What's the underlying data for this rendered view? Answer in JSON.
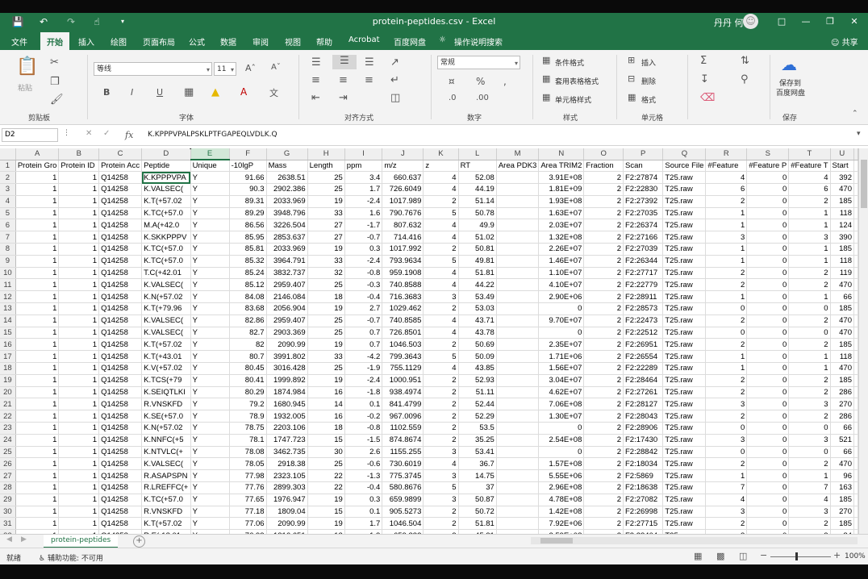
{
  "window": {
    "doc_title": "protein-peptides.csv - Excel",
    "user": "丹丹 何",
    "quick_access": [
      "save-icon",
      "undo-icon",
      "redo-icon",
      "touch-mode-icon",
      "customize-icon"
    ]
  },
  "ribbon_tabs": [
    "文件",
    "开始",
    "插入",
    "绘图",
    "页面布局",
    "公式",
    "数据",
    "审阅",
    "视图",
    "帮助",
    "Acrobat",
    "百度网盘",
    "操作说明搜索"
  ],
  "share_label": "共享",
  "ribbon": {
    "clipboard": {
      "paste": "粘贴",
      "label": "剪贴板"
    },
    "font": {
      "name": "等线",
      "size": "11",
      "label": "字体"
    },
    "alignment": {
      "label": "对齐方式"
    },
    "number": {
      "format": "常规",
      "label": "数字"
    },
    "styles": {
      "conditional": "条件格式",
      "table": "套用表格格式",
      "cell": "单元格样式",
      "label": "样式"
    },
    "cells": {
      "insert": "插入",
      "delete": "删除",
      "format": "格式",
      "label": "单元格"
    },
    "save": {
      "line1": "保存到",
      "line2": "百度网盘",
      "label": "保存"
    }
  },
  "formula_bar": {
    "name_box": "D2",
    "fx": "fx",
    "formula": "K.KPPPVPALPSKLPTFGAPEQLVDLK.Q"
  },
  "columns": [
    "A",
    "B",
    "C",
    "D",
    "E",
    "F",
    "G",
    "H",
    "I",
    "J",
    "K",
    "L",
    "M",
    "N",
    "O",
    "P",
    "Q",
    "R",
    "S",
    "T",
    "U"
  ],
  "headers": [
    "Protein Gro",
    "Protein ID",
    "Protein Acc",
    "Peptide",
    "Unique",
    "-10lgP",
    "Mass",
    "Length",
    "ppm",
    "m/z",
    "z",
    "RT",
    "Area PDK3",
    "Area TRIM2",
    "Fraction",
    "Scan",
    "Source File",
    "#Feature",
    "#Feature P",
    "#Feature T",
    "Start"
  ],
  "rows": [
    [
      "1",
      "1",
      "Q14258",
      "K.KPPPVPA",
      "Y",
      "91.66",
      "2638.51",
      "25",
      "3.4",
      "660.637",
      "4",
      "52.08",
      "",
      "3.91E+08",
      "2",
      "F2:27874",
      "T25.raw",
      "4",
      "0",
      "4",
      "392"
    ],
    [
      "1",
      "1",
      "Q14258",
      "K.VALSEC(",
      "Y",
      "90.3",
      "2902.386",
      "25",
      "1.7",
      "726.6049",
      "4",
      "44.19",
      "",
      "1.81E+09",
      "2",
      "F2:22830",
      "T25.raw",
      "6",
      "0",
      "6",
      "470"
    ],
    [
      "1",
      "1",
      "Q14258",
      "K.T(+57.02",
      "Y",
      "89.31",
      "2033.969",
      "19",
      "-2.4",
      "1017.989",
      "2",
      "51.14",
      "",
      "1.93E+08",
      "2",
      "F2:27392",
      "T25.raw",
      "2",
      "0",
      "2",
      "185"
    ],
    [
      "1",
      "1",
      "Q14258",
      "K.TC(+57.0",
      "Y",
      "89.29",
      "3948.796",
      "33",
      "1.6",
      "790.7676",
      "5",
      "50.78",
      "",
      "1.63E+07",
      "2",
      "F2:27035",
      "T25.raw",
      "1",
      "0",
      "1",
      "118"
    ],
    [
      "1",
      "1",
      "Q14258",
      "M.A(+42.0",
      "Y",
      "86.56",
      "3226.504",
      "27",
      "-1.7",
      "807.632",
      "4",
      "49.9",
      "",
      "2.03E+07",
      "2",
      "F2:26374",
      "T25.raw",
      "1",
      "0",
      "1",
      "124"
    ],
    [
      "1",
      "1",
      "Q14258",
      "K.SKKPPPV",
      "Y",
      "85.95",
      "2853.637",
      "27",
      "-0.7",
      "714.416",
      "4",
      "51.02",
      "",
      "1.32E+08",
      "2",
      "F2:27166",
      "T25.raw",
      "3",
      "0",
      "3",
      "390"
    ],
    [
      "1",
      "1",
      "Q14258",
      "K.TC(+57.0",
      "Y",
      "85.81",
      "2033.969",
      "19",
      "0.3",
      "1017.992",
      "2",
      "50.81",
      "",
      "2.26E+07",
      "2",
      "F2:27039",
      "T25.raw",
      "1",
      "0",
      "1",
      "185"
    ],
    [
      "1",
      "1",
      "Q14258",
      "K.TC(+57.0",
      "Y",
      "85.32",
      "3964.791",
      "33",
      "-2.4",
      "793.9634",
      "5",
      "49.81",
      "",
      "1.46E+07",
      "2",
      "F2:26344",
      "T25.raw",
      "1",
      "0",
      "1",
      "118"
    ],
    [
      "1",
      "1",
      "Q14258",
      "T.C(+42.01",
      "Y",
      "85.24",
      "3832.737",
      "32",
      "-0.8",
      "959.1908",
      "4",
      "51.81",
      "",
      "1.10E+07",
      "2",
      "F2:27717",
      "T25.raw",
      "2",
      "0",
      "2",
      "119"
    ],
    [
      "1",
      "1",
      "Q14258",
      "K.VALSEC(",
      "Y",
      "85.12",
      "2959.407",
      "25",
      "-0.3",
      "740.8588",
      "4",
      "44.22",
      "",
      "4.10E+07",
      "2",
      "F2:22779",
      "T25.raw",
      "2",
      "0",
      "2",
      "470"
    ],
    [
      "1",
      "1",
      "Q14258",
      "K.N(+57.02",
      "Y",
      "84.08",
      "2146.084",
      "18",
      "-0.4",
      "716.3683",
      "3",
      "53.49",
      "",
      "2.90E+06",
      "2",
      "F2:28911",
      "T25.raw",
      "1",
      "0",
      "1",
      "66"
    ],
    [
      "1",
      "1",
      "Q14258",
      "K.T(+79.96",
      "Y",
      "83.68",
      "2056.904",
      "19",
      "2.7",
      "1029.462",
      "2",
      "53.03",
      "",
      "0",
      "2",
      "F2:28573",
      "T25.raw",
      "0",
      "0",
      "0",
      "185"
    ],
    [
      "1",
      "1",
      "Q14258",
      "K.VALSEC(",
      "Y",
      "82.86",
      "2959.407",
      "25",
      "-0.7",
      "740.8585",
      "4",
      "43.71",
      "",
      "9.70E+07",
      "2",
      "F2:22473",
      "T25.raw",
      "2",
      "0",
      "2",
      "470"
    ],
    [
      "1",
      "1",
      "Q14258",
      "K.VALSEC(",
      "Y",
      "82.7",
      "2903.369",
      "25",
      "0.7",
      "726.8501",
      "4",
      "43.78",
      "",
      "0",
      "2",
      "F2:22512",
      "T25.raw",
      "0",
      "0",
      "0",
      "470"
    ],
    [
      "1",
      "1",
      "Q14258",
      "K.T(+57.02",
      "Y",
      "82",
      "2090.99",
      "19",
      "0.7",
      "1046.503",
      "2",
      "50.69",
      "",
      "2.35E+07",
      "2",
      "F2:26951",
      "T25.raw",
      "2",
      "0",
      "2",
      "185"
    ],
    [
      "1",
      "1",
      "Q14258",
      "K.T(+43.01",
      "Y",
      "80.7",
      "3991.802",
      "33",
      "-4.2",
      "799.3643",
      "5",
      "50.09",
      "",
      "1.71E+06",
      "2",
      "F2:26554",
      "T25.raw",
      "1",
      "0",
      "1",
      "118"
    ],
    [
      "1",
      "1",
      "Q14258",
      "K.V(+57.02",
      "Y",
      "80.45",
      "3016.428",
      "25",
      "-1.9",
      "755.1129",
      "4",
      "43.85",
      "",
      "1.56E+07",
      "2",
      "F2:22289",
      "T25.raw",
      "1",
      "0",
      "1",
      "470"
    ],
    [
      "1",
      "1",
      "Q14258",
      "K.TCS(+79",
      "Y",
      "80.41",
      "1999.892",
      "19",
      "-2.4",
      "1000.951",
      "2",
      "52.93",
      "",
      "3.04E+07",
      "2",
      "F2:28464",
      "T25.raw",
      "2",
      "0",
      "2",
      "185"
    ],
    [
      "1",
      "1",
      "Q14258",
      "K.SEIQTLKI",
      "Y",
      "80.29",
      "1874.984",
      "16",
      "-1.8",
      "938.4974",
      "2",
      "51.11",
      "",
      "4.62E+07",
      "2",
      "F2:27261",
      "T25.raw",
      "2",
      "0",
      "2",
      "286"
    ],
    [
      "1",
      "1",
      "Q14258",
      "R.VNSKFD",
      "Y",
      "79.2",
      "1680.945",
      "14",
      "0.1",
      "841.4799",
      "2",
      "52.44",
      "",
      "7.06E+08",
      "2",
      "F2:28127",
      "T25.raw",
      "3",
      "0",
      "3",
      "270"
    ],
    [
      "1",
      "1",
      "Q14258",
      "K.SE(+57.0",
      "Y",
      "78.9",
      "1932.005",
      "16",
      "-0.2",
      "967.0096",
      "2",
      "52.29",
      "",
      "1.30E+07",
      "2",
      "F2:28043",
      "T25.raw",
      "2",
      "0",
      "2",
      "286"
    ],
    [
      "1",
      "1",
      "Q14258",
      "K.N(+57.02",
      "Y",
      "78.75",
      "2203.106",
      "18",
      "-0.8",
      "1102.559",
      "2",
      "53.5",
      "",
      "0",
      "2",
      "F2:28906",
      "T25.raw",
      "0",
      "0",
      "0",
      "66"
    ],
    [
      "1",
      "1",
      "Q14258",
      "K.NNFC(+5",
      "Y",
      "78.1",
      "1747.723",
      "15",
      "-1.5",
      "874.8674",
      "2",
      "35.25",
      "",
      "2.54E+08",
      "2",
      "F2:17430",
      "T25.raw",
      "3",
      "0",
      "3",
      "521"
    ],
    [
      "1",
      "1",
      "Q14258",
      "K.NTVLC(+",
      "Y",
      "78.08",
      "3462.735",
      "30",
      "2.6",
      "1155.255",
      "3",
      "53.41",
      "",
      "0",
      "2",
      "F2:28842",
      "T25.raw",
      "0",
      "0",
      "0",
      "66"
    ],
    [
      "1",
      "1",
      "Q14258",
      "K.VALSEC(",
      "Y",
      "78.05",
      "2918.38",
      "25",
      "-0.6",
      "730.6019",
      "4",
      "36.7",
      "",
      "1.57E+08",
      "2",
      "F2:18034",
      "T25.raw",
      "2",
      "0",
      "2",
      "470"
    ],
    [
      "1",
      "1",
      "Q14258",
      "R.ASAPSPN",
      "Y",
      "77.98",
      "2323.105",
      "22",
      "-1.3",
      "775.3745",
      "3",
      "14.75",
      "",
      "5.55E+06",
      "2",
      "F2:5869",
      "T25.raw",
      "1",
      "0",
      "1",
      "96"
    ],
    [
      "1",
      "1",
      "Q14258",
      "R.LREFFC(+",
      "Y",
      "77.76",
      "2899.303",
      "22",
      "-0.4",
      "580.8676",
      "5",
      "37",
      "",
      "2.96E+08",
      "2",
      "F2:18638",
      "T25.raw",
      "7",
      "0",
      "7",
      "163"
    ],
    [
      "1",
      "1",
      "Q14258",
      "K.TC(+57.0",
      "Y",
      "77.65",
      "1976.947",
      "19",
      "0.3",
      "659.9899",
      "3",
      "50.87",
      "",
      "4.78E+08",
      "2",
      "F2:27082",
      "T25.raw",
      "4",
      "0",
      "4",
      "185"
    ],
    [
      "1",
      "1",
      "Q14258",
      "R.VNSKFD",
      "Y",
      "77.18",
      "1809.04",
      "15",
      "0.1",
      "905.5273",
      "2",
      "50.72",
      "",
      "1.42E+08",
      "2",
      "F2:26998",
      "T25.raw",
      "3",
      "0",
      "3",
      "270"
    ],
    [
      "1",
      "1",
      "Q14258",
      "K.T(+57.02",
      "Y",
      "77.06",
      "2090.99",
      "19",
      "1.7",
      "1046.504",
      "2",
      "51.81",
      "",
      "7.92E+06",
      "2",
      "F2:27715",
      "T25.raw",
      "2",
      "0",
      "2",
      "185"
    ],
    [
      "1",
      "1",
      "Q14258",
      "R.E(-18.01",
      "Y",
      "76.93",
      "1316.651",
      "12",
      "-1.3",
      "659.332",
      "2",
      "45.21",
      "",
      "2.59E+08",
      "2",
      "F2:23404",
      "T25.raw",
      "3",
      "0",
      "3",
      "84"
    ],
    [
      "1",
      "1",
      "Q14258",
      "K.KSEIQTLK",
      "Y",
      "76.63",
      "2003.079",
      "17",
      "0",
      "1002.547",
      "2",
      "50.66",
      "",
      "1.24E+08",
      "2",
      "F2:26898",
      "T25.raw",
      "3",
      "0",
      "3",
      "285"
    ],
    [
      "1",
      "1",
      "Q14258",
      "P.PPVPALP",
      "Y",
      "76.07",
      "2413.362",
      "23",
      "2.4",
      "805.4632",
      "3",
      "53.03",
      "",
      "2.65E+05",
      "2",
      "F2:28579",
      "T25.raw",
      "1",
      "0",
      "1",
      "394"
    ],
    [
      "1",
      "1",
      "Q14258",
      "K.VALSEC(",
      "Y",
      "75.86",
      "2287.061",
      "20",
      "-1.2",
      "763.3601",
      "3",
      "50.24",
      "",
      "3.21E+06",
      "2",
      "F2:26651",
      "T25.raw",
      "1",
      "0",
      "1",
      "470"
    ]
  ],
  "sheet_tab": "protein-peptides",
  "status": {
    "ready": "就绪",
    "accessibility": "辅助功能: 不可用",
    "zoom": "100%"
  }
}
